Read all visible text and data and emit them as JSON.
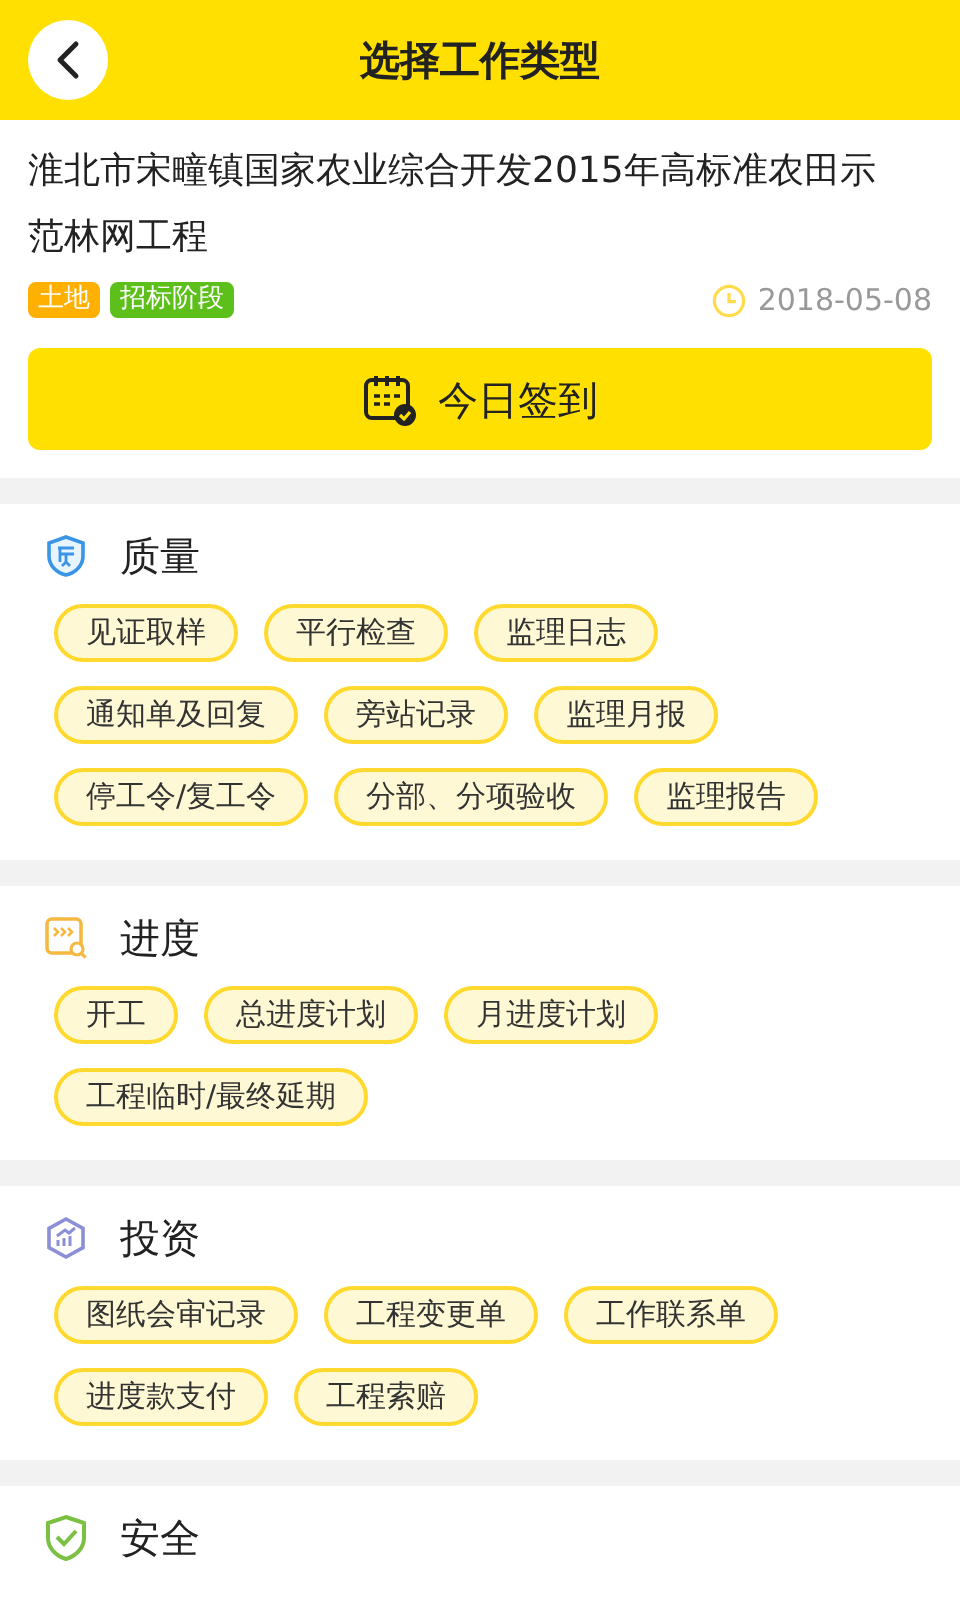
{
  "header": {
    "title": "选择工作类型"
  },
  "project": {
    "name": "淮北市宋疃镇国家农业综合开发2015年高标准农田示范林网工程",
    "tags": [
      {
        "label": "土地",
        "color": "#ffb000"
      },
      {
        "label": "招标阶段",
        "color": "#5cbf1a"
      }
    ],
    "date": "2018-05-08"
  },
  "checkin_button": {
    "label": "今日签到"
  },
  "sections": [
    {
      "kind": "quality",
      "title": "质量",
      "items": [
        "见证取样",
        "平行检查",
        "监理日志",
        "通知单及回复",
        "旁站记录",
        "监理月报",
        "停工令/复工令",
        "分部、分项验收",
        "监理报告"
      ]
    },
    {
      "kind": "progress",
      "title": "进度",
      "items": [
        "开工",
        "总进度计划",
        "月进度计划",
        "工程临时/最终延期"
      ]
    },
    {
      "kind": "investment",
      "title": "投资",
      "items": [
        "图纸会审记录",
        "工程变更单",
        "工作联系单",
        "进度款支付",
        "工程索赔"
      ]
    },
    {
      "kind": "safety",
      "title": "安全"
    }
  ]
}
